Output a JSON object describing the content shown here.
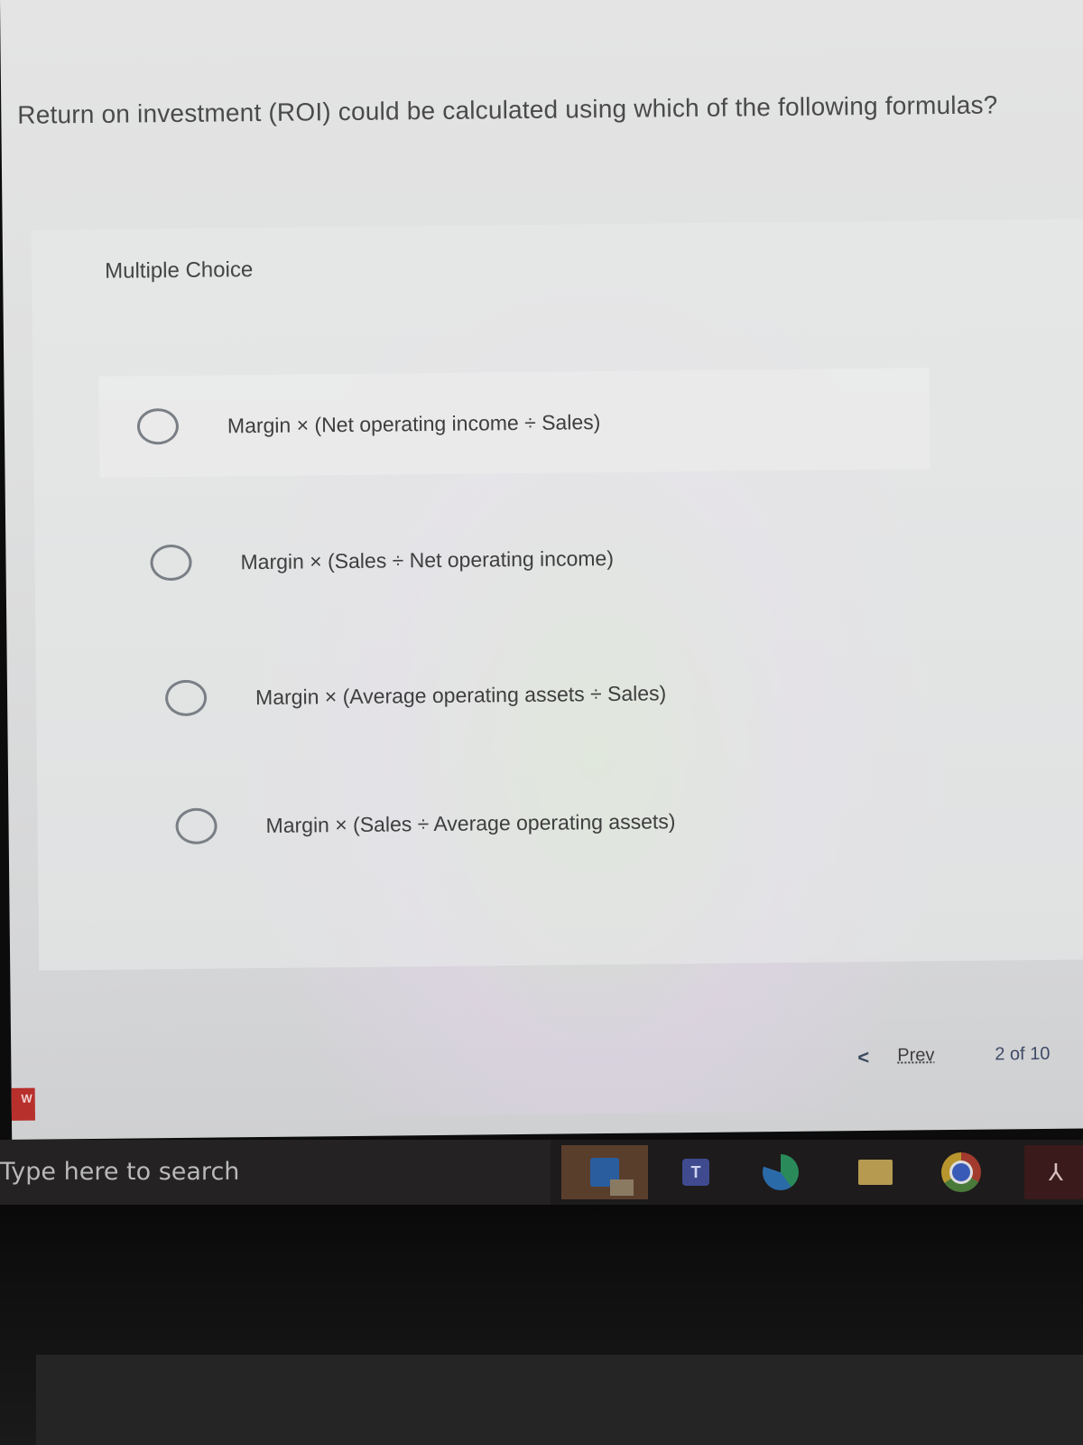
{
  "question": {
    "text": "Return on investment (ROI) could be calculated using which of the following formulas?",
    "type_label": "Multiple Choice",
    "options": [
      {
        "label": "Margin × (Net operating income ÷ Sales)",
        "selected": false
      },
      {
        "label": "Margin × (Sales ÷ Net operating income)",
        "selected": false
      },
      {
        "label": "Margin × (Average operating assets ÷ Sales)",
        "selected": false
      },
      {
        "label": "Margin × (Sales ÷ Average operating assets)",
        "selected": false
      }
    ]
  },
  "navigation": {
    "prev_chevron": "<",
    "prev_label": "Prev",
    "current_page": 2,
    "total_pages": 10,
    "page_count_text": "2 of 10"
  },
  "side_tab": {
    "label": "W"
  },
  "taskbar": {
    "search_placeholder": "Type here to search",
    "apps": [
      {
        "name": "Outlook",
        "icon": "outlook-icon"
      },
      {
        "name": "Teams",
        "icon": "teams-icon",
        "glyph": "T"
      },
      {
        "name": "Edge",
        "icon": "edge-icon"
      },
      {
        "name": "File Explorer",
        "icon": "folder-icon"
      },
      {
        "name": "Chrome",
        "icon": "chrome-icon"
      },
      {
        "name": "Acrobat",
        "icon": "acrobat-icon",
        "glyph": "⅄"
      }
    ]
  }
}
